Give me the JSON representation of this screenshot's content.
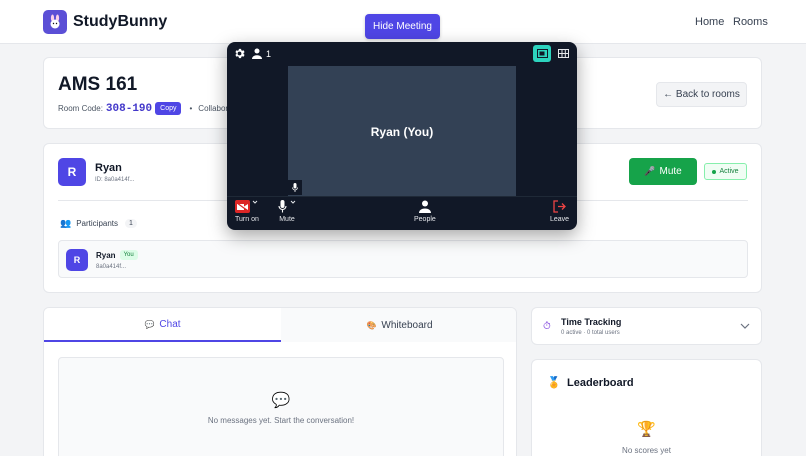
{
  "header": {
    "brand": "StudyBunny",
    "nav": {
      "home": "Home",
      "rooms": "Rooms"
    },
    "hide_meeting": "Hide Meeting"
  },
  "room": {
    "title": "AMS 161",
    "code_label": "Room Code:",
    "code": "308-190",
    "copy_label": "Copy",
    "separator": "•",
    "collab_text": "Collabor",
    "back_label": "← Back to rooms"
  },
  "user": {
    "initial": "R",
    "name": "Ryan",
    "id_text": "ID: 8a0a414f...",
    "mute_label": "Mute",
    "status": "Active"
  },
  "participants": {
    "label": "Participants",
    "count": "1",
    "items": [
      {
        "initial": "R",
        "name": "Ryan",
        "badge": "You",
        "id": "8a0a414f..."
      }
    ]
  },
  "tabs": {
    "chat": "Chat",
    "whiteboard": "Whiteboard"
  },
  "chat": {
    "empty": "No messages yet. Start the conversation!"
  },
  "time_tracking": {
    "title": "Time Tracking",
    "subtitle": "0 active · 0 total users"
  },
  "leaderboard": {
    "title": "Leaderboard",
    "empty": "No scores yet"
  },
  "meeting": {
    "participant_count": "1",
    "tile_name": "Ryan (You)",
    "controls": {
      "camera": "Turn on",
      "mic": "Mute",
      "people": "People",
      "leave": "Leave"
    }
  },
  "colors": {
    "accent": "#4f46e5",
    "success": "#16a34a",
    "meeting_bg": "#111827",
    "danger": "#dc2626"
  }
}
